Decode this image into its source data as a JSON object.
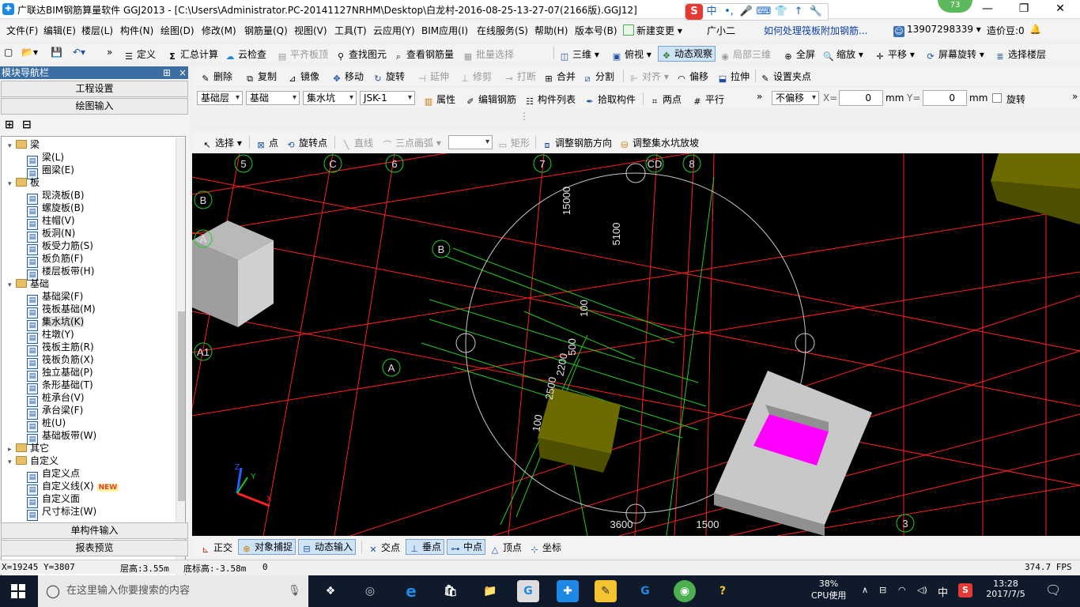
{
  "window": {
    "title": "广联达BIM钢筋算量软件 GGJ2013 - [C:\\Users\\Administrator.PC-20141127NRHM\\Desktop\\白龙村-2016-08-25-13-27-07(2166版).GGJ12]",
    "minimize": "—",
    "restore": "❐",
    "close": "✕",
    "badge_value": "73",
    "ime_items": [
      "S",
      "中",
      "•,",
      "🎤",
      "⌨",
      "👕",
      "↑",
      "🔧"
    ]
  },
  "menu": {
    "items": [
      "文件(F)",
      "编辑(E)",
      "楼层(L)",
      "构件(N)",
      "绘图(D)",
      "修改(M)",
      "钢筋量(Q)",
      "视图(V)",
      "工具(T)",
      "云应用(Y)",
      "BIM应用(I)",
      "在线服务(S)",
      "帮助(H)",
      "版本号(B)",
      "新建变更",
      "广小二"
    ],
    "news_link": "如何处理筏板附加钢筋...",
    "phone": "13907298339",
    "price_label": "造价豆:0"
  },
  "toolbar1": {
    "items": [
      "定义",
      "汇总计算",
      "云检查",
      "平齐板顶",
      "查找图元",
      "查看钢筋量",
      "批量选择",
      "三维",
      "俯视",
      "动态观察",
      "局部三维",
      "全屏",
      "缩放",
      "平移",
      "屏幕旋转",
      "选择楼层"
    ]
  },
  "toolbar2": {
    "items": [
      "删除",
      "复制",
      "镜像",
      "移动",
      "旋转",
      "延伸",
      "修剪",
      "打断",
      "合并",
      "分割",
      "对齐",
      "偏移",
      "拉伸",
      "设置夹点"
    ]
  },
  "toolbar3": {
    "layer": "基础层",
    "category": "基础",
    "type": "集水坑",
    "component": "JSK-1",
    "items": [
      "属性",
      "编辑钢筋",
      "构件列表",
      "拾取构件",
      "两点",
      "平行"
    ],
    "offset_mode": "不偏移",
    "x_label": "X=",
    "x_value": "0",
    "y_label": "Y=",
    "y_value": "0",
    "unit": "mm",
    "rotate_label": "旋转"
  },
  "toolbar4": {
    "items": [
      "选择",
      "点",
      "旋转点",
      "直线",
      "三点画弧",
      "矩形",
      "调整钢筋方向",
      "调整集水坑放坡"
    ]
  },
  "left_panel": {
    "title": "模块导航栏",
    "pin": "⊞",
    "close": "×",
    "btn_project": "工程设置",
    "btn_draw": "绘图输入",
    "btn_single": "单构件输入",
    "btn_report": "报表预览",
    "tree": [
      {
        "label": "梁",
        "type": "folder",
        "open": true,
        "level": 0
      },
      {
        "label": "梁(L)",
        "type": "leaf",
        "level": 1
      },
      {
        "label": "圈梁(E)",
        "type": "leaf",
        "level": 1
      },
      {
        "label": "板",
        "type": "folder",
        "open": true,
        "level": 0
      },
      {
        "label": "现浇板(B)",
        "type": "leaf",
        "level": 1
      },
      {
        "label": "螺旋板(B)",
        "type": "leaf",
        "level": 1
      },
      {
        "label": "柱帽(V)",
        "type": "leaf",
        "level": 1
      },
      {
        "label": "板洞(N)",
        "type": "leaf",
        "level": 1
      },
      {
        "label": "板受力筋(S)",
        "type": "leaf",
        "level": 1
      },
      {
        "label": "板负筋(F)",
        "type": "leaf",
        "level": 1
      },
      {
        "label": "楼层板带(H)",
        "type": "leaf",
        "level": 1
      },
      {
        "label": "基础",
        "type": "folder",
        "open": true,
        "level": 0
      },
      {
        "label": "基础梁(F)",
        "type": "leaf",
        "level": 1
      },
      {
        "label": "筏板基础(M)",
        "type": "leaf",
        "level": 1
      },
      {
        "label": "集水坑(K)",
        "type": "leaf",
        "level": 1,
        "selected": true
      },
      {
        "label": "柱墩(Y)",
        "type": "leaf",
        "level": 1
      },
      {
        "label": "筏板主筋(R)",
        "type": "leaf",
        "level": 1
      },
      {
        "label": "筏板负筋(X)",
        "type": "leaf",
        "level": 1
      },
      {
        "label": "独立基础(P)",
        "type": "leaf",
        "level": 1
      },
      {
        "label": "条形基础(T)",
        "type": "leaf",
        "level": 1
      },
      {
        "label": "桩承台(V)",
        "type": "leaf",
        "level": 1
      },
      {
        "label": "承台梁(F)",
        "type": "leaf",
        "level": 1
      },
      {
        "label": "桩(U)",
        "type": "leaf",
        "level": 1
      },
      {
        "label": "基础板带(W)",
        "type": "leaf",
        "level": 1
      },
      {
        "label": "其它",
        "type": "folder",
        "open": false,
        "level": 0
      },
      {
        "label": "自定义",
        "type": "folder",
        "open": true,
        "level": 0
      },
      {
        "label": "自定义点",
        "type": "leaf",
        "level": 1
      },
      {
        "label": "自定义线(X)",
        "type": "leaf",
        "level": 1,
        "tag": "NEW"
      },
      {
        "label": "自定义面",
        "type": "leaf",
        "level": 1
      },
      {
        "label": "尺寸标注(W)",
        "type": "leaf",
        "level": 1
      }
    ]
  },
  "canvas": {
    "axis_labels": [
      "5",
      "C",
      "6",
      "7",
      "CD",
      "8",
      "B",
      "A",
      "B",
      "A",
      "A1",
      "3"
    ],
    "dimension_labels": [
      "15000",
      "5100",
      "100",
      "500",
      "2200",
      "2500",
      "100",
      "3600",
      "1500"
    ],
    "colors": {
      "grid": "#ff2020",
      "rebar": "#22cc22",
      "pit": "#c8c8c8",
      "magenta": "#ff00ff",
      "olive": "#6b6b00"
    }
  },
  "snapbar": {
    "items": [
      "正交",
      "对象捕捉",
      "动态输入",
      "交点",
      "垂点",
      "中点",
      "顶点",
      "坐标"
    ]
  },
  "status": {
    "coords": "X=19245 Y=3807",
    "floor_height": "层高:3.55m",
    "bottom_height": "底标高:-3.58m",
    "extra": "0",
    "fps": "374.7 FPS"
  },
  "taskbar": {
    "search_placeholder": "在这里输入你要搜索的内容",
    "cpu_pct": "38%",
    "cpu_label": "CPU使用",
    "lang": "中",
    "time": "13:28",
    "date": "2017/7/5"
  }
}
